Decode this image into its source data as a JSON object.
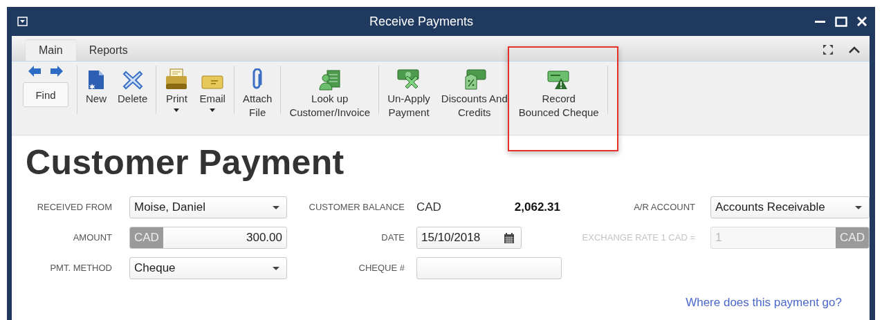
{
  "window": {
    "title": "Receive Payments"
  },
  "tabs": [
    {
      "label": "Main",
      "selected": true
    },
    {
      "label": "Reports",
      "selected": false
    }
  ],
  "toolbar": {
    "find_button": "Find",
    "groups": [
      [
        {
          "kind": "new",
          "label": "New",
          "has_menu": false,
          "highlighted": false
        },
        {
          "kind": "delete",
          "label": "Delete",
          "has_menu": false,
          "highlighted": false
        }
      ],
      [
        {
          "kind": "print",
          "label": "Print",
          "has_menu": true,
          "highlighted": false
        },
        {
          "kind": "email",
          "label": "Email",
          "has_menu": true,
          "highlighted": false
        }
      ],
      [
        {
          "kind": "attach",
          "label": "Attach\nFile",
          "has_menu": false,
          "highlighted": false
        }
      ],
      [
        {
          "kind": "lookup",
          "label": "Look up\nCustomer/Invoice",
          "has_menu": false,
          "highlighted": false
        }
      ],
      [
        {
          "kind": "unapply",
          "label": "Un-Apply\nPayment",
          "has_menu": false,
          "highlighted": false
        },
        {
          "kind": "discount",
          "label": "Discounts And\nCredits",
          "has_menu": false,
          "highlighted": false
        },
        {
          "kind": "bounced",
          "label": "Record\nBounced Cheque",
          "has_menu": false,
          "highlighted": true
        }
      ]
    ]
  },
  "form": {
    "heading": "Customer Payment",
    "fields": [
      {
        "kind": "dropdown",
        "label": "RECEIVED FROM",
        "value": "Moise, Daniel",
        "disabled": false
      },
      {
        "kind": "balance",
        "label": "CUSTOMER BALANCE",
        "currency": "CAD",
        "value": "2,062.31",
        "disabled": false
      },
      {
        "kind": "dropdown",
        "label": "A/R ACCOUNT",
        "value": "Accounts Receivable",
        "disabled": false
      },
      {
        "kind": "amount",
        "label": "AMOUNT",
        "currency": "CAD",
        "value": "300.00",
        "disabled": false
      },
      {
        "kind": "date",
        "label": "DATE",
        "value": "15/10/2018",
        "disabled": false
      },
      {
        "kind": "rate",
        "label": "EXCHANGE RATE 1 CAD =",
        "currency": "CAD",
        "value": "1",
        "disabled": true
      },
      {
        "kind": "dropdown",
        "label": "PMT. METHOD",
        "value": "Cheque",
        "disabled": false
      },
      {
        "kind": "text",
        "label": "CHEQUE #",
        "disabled": false
      }
    ],
    "link": "Where does this payment go?"
  }
}
